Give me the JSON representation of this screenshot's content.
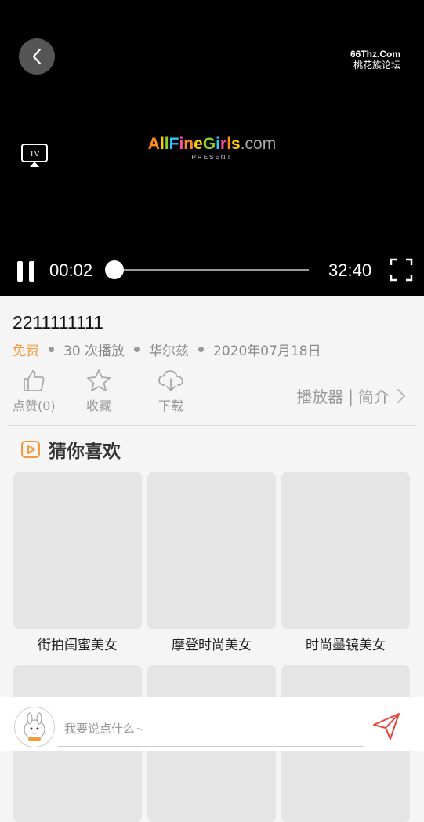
{
  "player": {
    "watermark_line1": "66Thz.Com",
    "watermark_line2": "桃花族论坛",
    "tv_label": "TV",
    "logo_brand_parts": [
      "A",
      "l",
      "l",
      "F",
      "i",
      "n",
      "e",
      "G",
      "i",
      "r",
      "l",
      "s"
    ],
    "logo_domain": ".com",
    "logo_present": "PRESENT",
    "current_time": "00:02",
    "total_time": "32:40",
    "progress": 0.001
  },
  "video": {
    "title": "2211111111",
    "price": "免费",
    "plays": "30 次播放",
    "author": "华尔兹",
    "date": "2020年07月18日"
  },
  "actions": {
    "like": "点赞(0)",
    "favorite": "收藏",
    "download": "下载",
    "player_link": "播放器",
    "separator": "|",
    "intro_link": "简介"
  },
  "recommend": {
    "heading": "猜你喜欢",
    "items": [
      {
        "label": "街拍闺蜜美女"
      },
      {
        "label": "摩登时尚美女"
      },
      {
        "label": "时尚墨镜美女"
      }
    ]
  },
  "comment": {
    "placeholder": "我要说点什么~"
  },
  "colors": {
    "accent": "#f39a3c",
    "logo_colors": [
      "#ff8c1a",
      "#ffcc00",
      "#8bd22e",
      "#2ec7ff",
      "#ff4fa3"
    ]
  }
}
